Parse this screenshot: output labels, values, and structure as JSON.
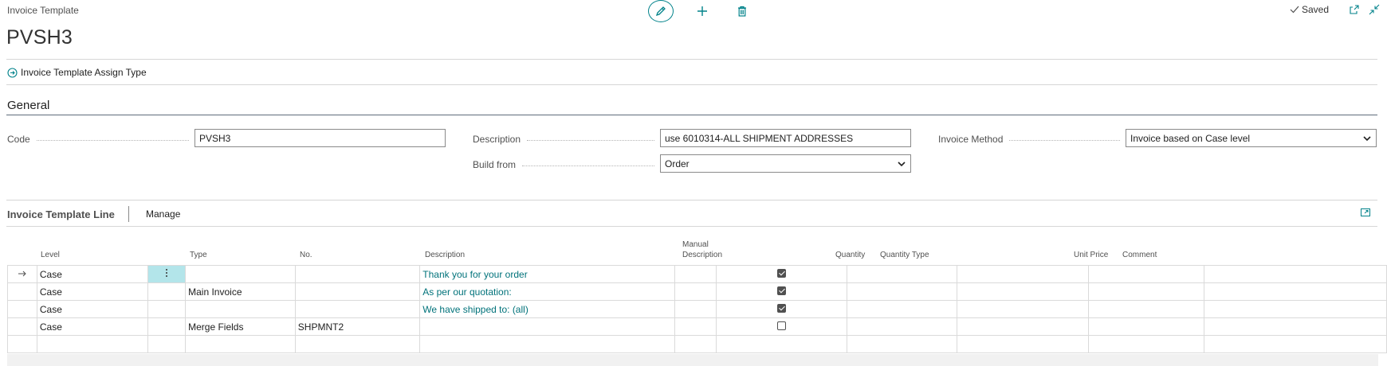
{
  "header": {
    "breadcrumb": "Invoice Template",
    "title": "PVSH3",
    "saved_label": "Saved"
  },
  "toolbar": {
    "edit_icon": "pencil-icon",
    "new_icon": "plus-icon",
    "delete_icon": "trash-icon"
  },
  "actions": {
    "assign_type_label": "Invoice Template Assign Type"
  },
  "general": {
    "section_title": "General",
    "code_label": "Code",
    "code_value": "PVSH3",
    "description_label": "Description",
    "description_value": "use 6010314-ALL SHIPMENT ADDRESSES",
    "build_from_label": "Build from",
    "build_from_value": "Order",
    "invoice_method_label": "Invoice Method",
    "invoice_method_value": "Invoice based on Case level"
  },
  "lines": {
    "title": "Invoice Template Line",
    "manage_label": "Manage",
    "columns": {
      "level": "Level",
      "type": "Type",
      "no": "No.",
      "description": "Description",
      "manual_line1": "Manual",
      "manual_line2": "Description",
      "quantity": "Quantity",
      "quantity_type": "Quantity Type",
      "unit_price": "Unit Price",
      "comment": "Comment"
    },
    "rows": [
      {
        "level": "Case",
        "type": "",
        "no": "",
        "description": "Thank you for your order",
        "manual": true
      },
      {
        "level": "Case",
        "type": "Main Invoice",
        "no": "",
        "description": "As per our quotation:",
        "manual": true
      },
      {
        "level": "Case",
        "type": "",
        "no": "",
        "description": "We have shipped to: (all)",
        "manual": true
      },
      {
        "level": "Case",
        "type": "Merge Fields",
        "no": "SHPMNT2",
        "description": "",
        "manual": false
      }
    ]
  },
  "colors": {
    "accent": "#00828a",
    "link": "#00727a",
    "selected_cell": "#b3e5ea"
  }
}
